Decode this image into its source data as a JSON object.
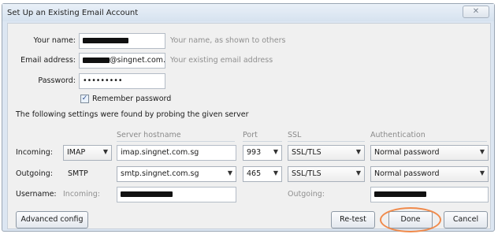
{
  "window": {
    "title": "Set Up an Existing Email Account",
    "close_glyph": "✕"
  },
  "identity": {
    "name_label": "Your name:",
    "name_hint": "Your name, as shown to others",
    "email_label": "Email address:",
    "email_domain": "@singnet.com.sg",
    "email_hint": "Your existing email address",
    "password_label": "Password:",
    "password_value": "•••••••••",
    "remember_label": "Remember password",
    "remember_checked": true
  },
  "found_message": "The following settings were found by probing the given server",
  "columns": {
    "hostname": "Server hostname",
    "port": "Port",
    "ssl": "SSL",
    "auth": "Authentication"
  },
  "incoming": {
    "label": "Incoming:",
    "protocol": "IMAP",
    "hostname": "imap.singnet.com.sg",
    "port": "993",
    "ssl": "SSL/TLS",
    "auth": "Normal password"
  },
  "outgoing": {
    "label": "Outgoing:",
    "protocol": "SMTP",
    "hostname": "smtp.singnet.com.sg",
    "port": "465",
    "ssl": "SSL/TLS",
    "auth": "Normal password"
  },
  "username": {
    "label": "Username:",
    "incoming_label": "Incoming:",
    "outgoing_label": "Outgoing:"
  },
  "buttons": {
    "advanced": "Advanced config",
    "retest": "Re-test",
    "done": "Done",
    "cancel": "Cancel"
  },
  "colors": {
    "highlight": "#f08a4b",
    "frame": "#dce6f2"
  },
  "icons": {
    "dropdown": "▼",
    "check": "✓"
  }
}
